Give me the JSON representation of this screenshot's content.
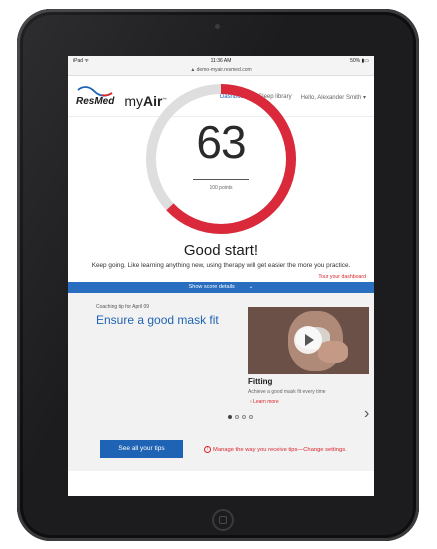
{
  "status": {
    "carrier": "iPad ᯤ",
    "time": "11:36 AM",
    "battery": "50% ▮▭"
  },
  "url": "▲ demo-myair.resmed.com",
  "header": {
    "logo_text": "ResMed",
    "app_name_prefix": "my",
    "app_name_bold": "Air",
    "app_name_mark": "™",
    "nav": [
      {
        "label": "Dashboard",
        "active": true
      },
      {
        "label": "Sleep library",
        "active": false
      },
      {
        "label": "Hello, Alexander Smith ▾",
        "active": false
      }
    ]
  },
  "score": {
    "value": "63",
    "points_label": "100 points",
    "fraction": 0.63,
    "headline": "Good start!",
    "message": "Keep going. Like learning anything new, using therapy will get easier the more you practice.",
    "tour_link": "Tour your dashboard"
  },
  "score_details": {
    "label": "Show score details",
    "chevron": "⌄"
  },
  "coaching": {
    "date": "Coaching tip for April 09",
    "title": "Ensure a good mask fit",
    "video_title": "Fitting",
    "video_desc": "Achieve a good mask fit every time",
    "learn_more": "› Learn more",
    "next": "›",
    "see_all": "See all your tips",
    "manage": "Manage the way you receive tips—Change settings."
  },
  "colors": {
    "accent_blue": "#1f64b4",
    "alert_red": "#d8262c",
    "gauge_red": "#d9293a",
    "gauge_gray": "#dedede"
  }
}
